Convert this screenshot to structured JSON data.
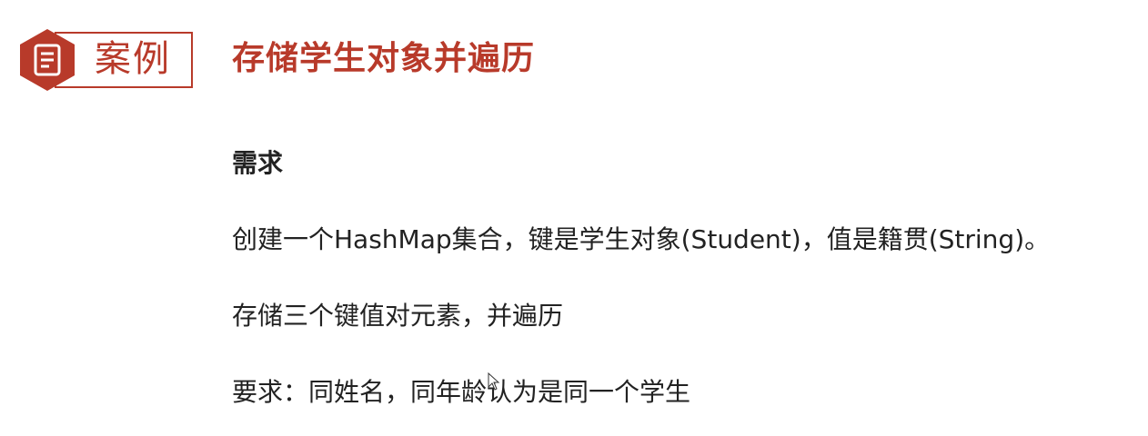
{
  "badge": {
    "label": "案例",
    "icon": "document-icon",
    "accent_color": "#b83a2a"
  },
  "title": "存储学生对象并遍历",
  "section_heading": "需求",
  "paragraphs": [
    "创建一个HashMap集合，键是学生对象(Student)，值是籍贯(String)。",
    "存储三个键值对元素，并遍历",
    "要求：同姓名，同年龄认为是同一个学生"
  ]
}
